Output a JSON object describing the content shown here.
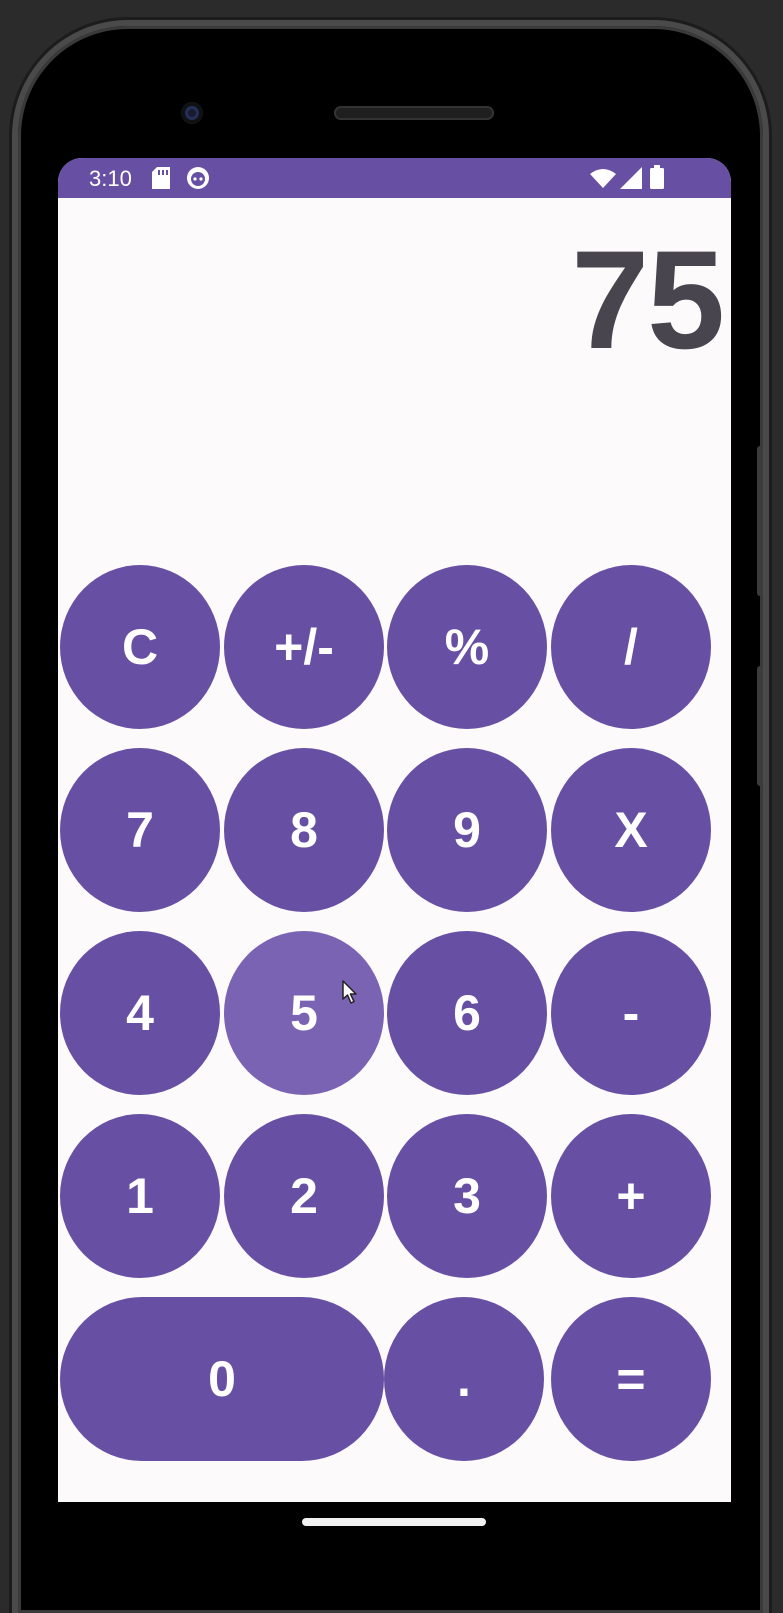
{
  "status_bar": {
    "time": "3:10",
    "icons_left": [
      "sd-card-icon",
      "android-debug-icon"
    ],
    "icons_right": [
      "wifi-icon",
      "signal-icon",
      "battery-icon"
    ]
  },
  "display": {
    "value": "75"
  },
  "keypad": {
    "row1": [
      "C",
      "+/-",
      "%",
      "/"
    ],
    "row2": [
      "7",
      "8",
      "9",
      "X"
    ],
    "row3": [
      "4",
      "5",
      "6",
      "-"
    ],
    "row4": [
      "1",
      "2",
      "3",
      "+"
    ],
    "row5": [
      "0",
      ".",
      "="
    ]
  },
  "pressed_key": "5",
  "colors": {
    "accent": "#6750a4",
    "pressed": "#7a63b3",
    "display_text": "#49454f",
    "background": "#fdfafb"
  }
}
